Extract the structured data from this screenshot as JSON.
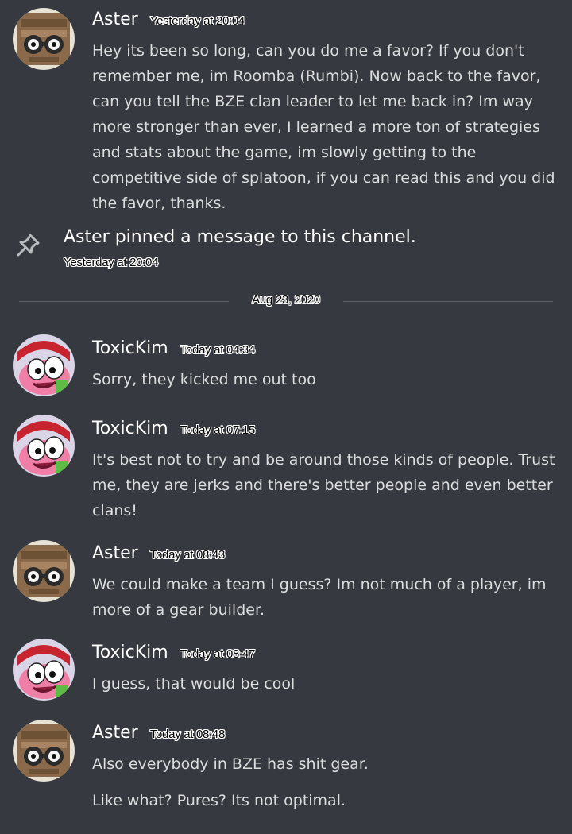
{
  "messages": [
    {
      "author": "Aster",
      "timestamp": "Yesterday at 20:04",
      "lines": [
        "Hey its been so long, can you do me a favor? If you don't remember me, im Roomba (Rumbi). Now back to the favor, can you tell the BZE clan leader to let me back in? Im way more stronger than ever, I learned a more ton of strategies and stats about the game, im slowly getting to the competitive side of splatoon, if you can read this and you did the favor, thanks."
      ]
    },
    {
      "author": "ToxicKim",
      "timestamp": "Today at 04:34",
      "lines": [
        "Sorry, they kicked me out too"
      ]
    },
    {
      "author": "ToxicKim",
      "timestamp": "Today at 07:15",
      "lines": [
        "It's best not to try and be around those kinds of people. Trust me, they are jerks and there's better people and even better clans!"
      ]
    },
    {
      "author": "Aster",
      "timestamp": "Today at 08:43",
      "lines": [
        "We could make a team I guess? Im not much of a player, im more of a gear builder."
      ]
    },
    {
      "author": "ToxicKim",
      "timestamp": "Today at 08:47",
      "lines": [
        "I guess, that would be cool"
      ]
    },
    {
      "author": "Aster",
      "timestamp": "Today at 08:48",
      "lines": [
        "Also everybody in BZE has shit gear.",
        "Like what? Pures? Its not optimal."
      ]
    }
  ],
  "system": {
    "text": "Aster pinned a message to this channel.",
    "timestamp": "Yesterday at 20:04",
    "icon": "pin-icon"
  },
  "date_divider": "Aug 23, 2020",
  "colors": {
    "background": "#36393f",
    "text": "#dcddde",
    "username": "#ffffff",
    "divider": "#5d6067"
  }
}
